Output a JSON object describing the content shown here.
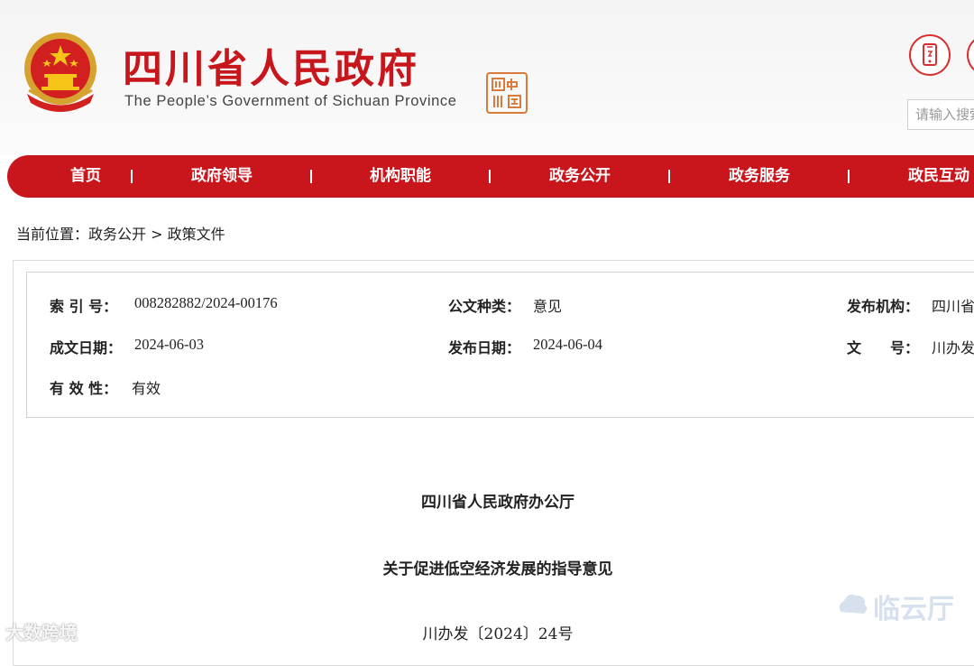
{
  "header": {
    "title": "四川省人民政府",
    "subtitle": "The People’s Government of Sichuan Province",
    "seal_text": "四川中國",
    "search": {
      "placeholder": "请输入搜索"
    },
    "colors": {
      "brand_red": "#c8161d",
      "seal_orange": "#d97b3a"
    },
    "icons": [
      "national-emblem-icon",
      "mobile-phone-icon"
    ]
  },
  "nav": {
    "items": [
      {
        "label": "首页"
      },
      {
        "label": "政府领导"
      },
      {
        "label": "机构职能"
      },
      {
        "label": "政务公开"
      },
      {
        "label": "政务服务"
      },
      {
        "label": "政民互动"
      }
    ]
  },
  "breadcrumb": {
    "prefix": "当前位置：",
    "items": [
      "政务公开",
      "政策文件"
    ],
    "separator": " > "
  },
  "info": {
    "index_label": "索 引 号：",
    "index_value": "008282882/2024-00176",
    "type_label": "公文种类：",
    "type_value": "意见",
    "publisher_label": "发布机构：",
    "publisher_value": "四川省",
    "created_label": "成文日期：",
    "created_value": "2024-06-03",
    "published_label": "发布日期：",
    "published_value": "2024-06-04",
    "docnum_label": "文　　号：",
    "docnum_value": "川办发",
    "validity_label": "有 效 性：",
    "validity_value": "有效"
  },
  "document": {
    "issuer": "四川省人民政府办公厅",
    "title": "关于促进低空经济发展的指导意见",
    "number": "川办发〔2024〕24号"
  },
  "watermarks": {
    "left": "大数跨境",
    "right": "临云厅"
  }
}
